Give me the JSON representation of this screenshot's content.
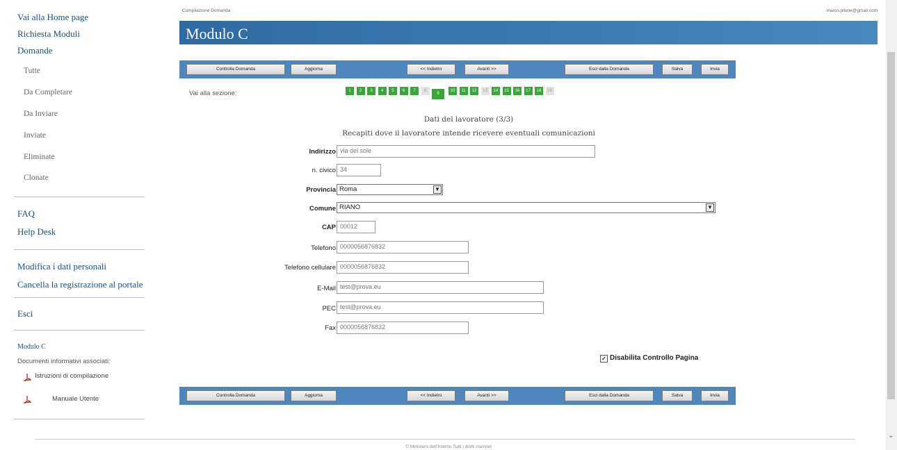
{
  "sidebar": {
    "home": "Vai alla Home page",
    "request_modules": "Richiesta Moduli",
    "applications": "Domande",
    "sub_items": [
      "Tutte",
      "Da Completare",
      "Da Inviare",
      "Inviate",
      "Eliminate",
      "Clonate"
    ],
    "faq": "FAQ",
    "help_desk": "Help Desk",
    "edit_personal": "Modifica i dati personali",
    "cancel_registration": "Cancella la registrazione al portale",
    "exit": "Esci",
    "module_title": "Modulo C",
    "associated_docs": "Documenti informativi associati:",
    "doc1": "Istruzioni di compilazione",
    "doc2": "Manuale Utente"
  },
  "header": {
    "crumb": "Compilazione Domanda",
    "user_email": "marco.pilone@gmail.com",
    "title": "Modulo C"
  },
  "toolbar": {
    "check": "Controlla Domanda",
    "update": "Aggiorna",
    "back": "<< Indietro",
    "forward": "Avanti >>",
    "exit": "Esci dalla Domanda",
    "save": "Salva",
    "send": "Invia"
  },
  "sections": {
    "label": "Vai alla sezione:",
    "items": [
      {
        "n": "1",
        "state": "done"
      },
      {
        "n": "2",
        "state": "done"
      },
      {
        "n": "3",
        "state": "done"
      },
      {
        "n": "4",
        "state": "done"
      },
      {
        "n": "5",
        "state": "done"
      },
      {
        "n": "6",
        "state": "done"
      },
      {
        "n": "7",
        "state": "done"
      },
      {
        "n": "8",
        "state": "off"
      },
      {
        "n": "9",
        "state": "current"
      },
      {
        "n": "10",
        "state": "done"
      },
      {
        "n": "11",
        "state": "done"
      },
      {
        "n": "12",
        "state": "done"
      },
      {
        "n": "13",
        "state": "off"
      },
      {
        "n": "14",
        "state": "done"
      },
      {
        "n": "15",
        "state": "done"
      },
      {
        "n": "16",
        "state": "done"
      },
      {
        "n": "17",
        "state": "done"
      },
      {
        "n": "18",
        "state": "done"
      },
      {
        "n": "19",
        "state": "off"
      }
    ]
  },
  "form": {
    "heading": "Dati del lavoratore (3/3)",
    "subheading": "Recapiti dove il lavoratore intende ricevere eventuali comunicazioni",
    "address_label": "Indirizzo",
    "address_value": "via del sole",
    "number_label": "n. civico",
    "number_value": "34",
    "province_label": "Provincia",
    "province_value": "Roma",
    "city_label": "Comune",
    "city_value": "RIANO",
    "cap_label": "CAP",
    "cap_value": "00012",
    "phone_label": "Telefono",
    "phone_value": "0000056876832",
    "mobile_label": "Telefono cellulare",
    "mobile_value": "0000056876832",
    "email_label": "E-Mail",
    "email_value": "test@prova.eu",
    "pec_label": "PEC",
    "pec_value": "test@prova.eu",
    "fax_label": "Fax",
    "fax_value": "0000056876832",
    "disable_check": "Disabilita Controllo Pagina"
  },
  "footer": {
    "text": "© Ministero dell'Interno Tutti i diritti riservati"
  },
  "colors": {
    "title_bar": "#2f6aa3",
    "toolbar": "#4f86bd",
    "section_done": "#3aa53a",
    "link": "#1d4f7a"
  }
}
